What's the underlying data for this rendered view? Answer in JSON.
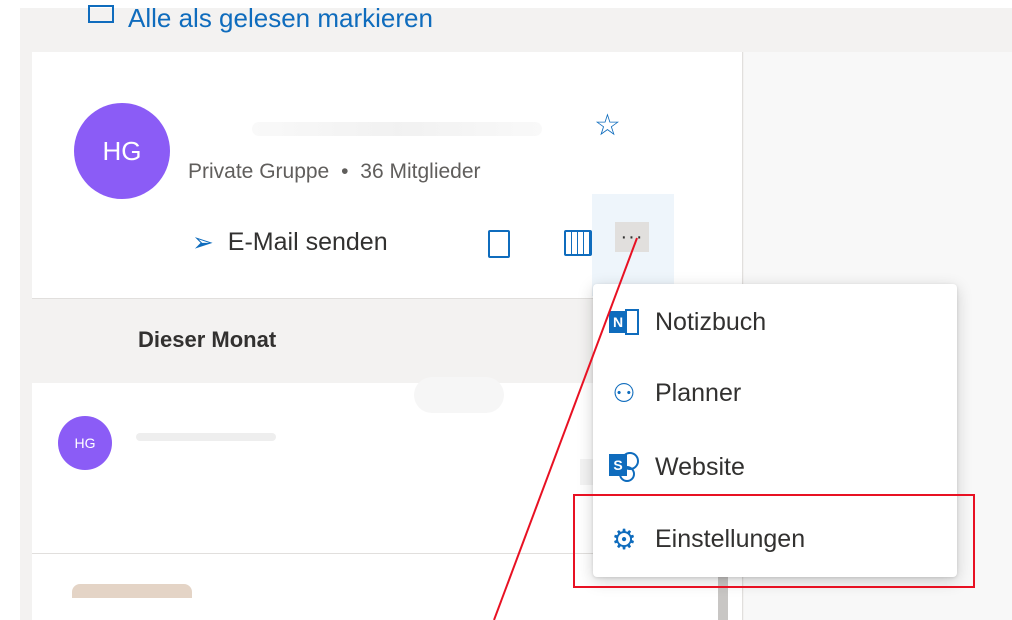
{
  "toolbar": {
    "mark_all_read": "Alle als gelesen markieren"
  },
  "group": {
    "avatar_initials": "HG",
    "visibility": "Private Gruppe",
    "member_count": "36 Mitglieder",
    "separator": "•"
  },
  "actions": {
    "send_email": "E-Mail senden",
    "more": "···"
  },
  "list": {
    "section_header": "Dieser Monat",
    "item_avatar": "HG"
  },
  "menu": {
    "items": [
      {
        "label": "Notizbuch",
        "icon": "onenote-icon"
      },
      {
        "label": "Planner",
        "icon": "planner-icon"
      },
      {
        "label": "Website",
        "icon": "sharepoint-icon"
      },
      {
        "label": "Einstellungen",
        "icon": "gear-icon"
      }
    ]
  },
  "colors": {
    "accent": "#0f6cbd",
    "avatar": "#8b5cf6",
    "highlight": "#e81123"
  }
}
